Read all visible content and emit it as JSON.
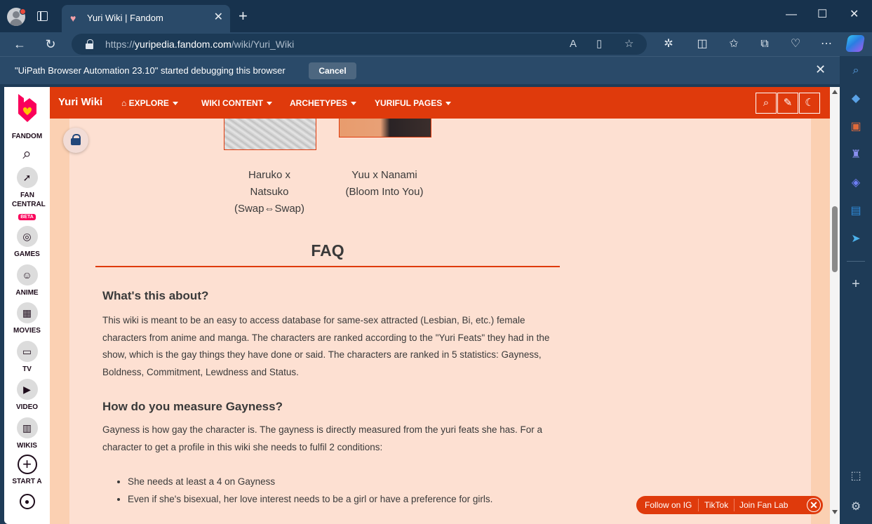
{
  "browser": {
    "tab_title": "Yuri Wiki | Fandom",
    "tab_close": "✕",
    "new_tab": "+",
    "url_prefix": "https://",
    "url_domain": "yuripedia.fandom.com",
    "url_path": "/wiki/Yuri_Wiki",
    "window_controls": {
      "minimize": "—",
      "maximize": "☐",
      "close": "✕"
    }
  },
  "debug_bar": {
    "message": "\"UiPath Browser Automation 23.10\" started debugging this browser",
    "cancel_label": "Cancel",
    "close": "✕"
  },
  "rail": {
    "items": [
      {
        "label": "FANDOM"
      },
      {
        "label": "FAN CENTRAL",
        "badge": "BETA"
      },
      {
        "label": "GAMES"
      },
      {
        "label": "ANIME"
      },
      {
        "label": "MOVIES"
      },
      {
        "label": "TV"
      },
      {
        "label": "VIDEO"
      },
      {
        "label": "WIKIS"
      },
      {
        "label": "START A"
      }
    ]
  },
  "wiki_header": {
    "name": "Yuri Wiki",
    "nav": [
      {
        "label": "EXPLORE"
      },
      {
        "label": "WIKI CONTENT"
      },
      {
        "label": "ARCHETYPES"
      },
      {
        "label": "YURIFUL PAGES"
      }
    ]
  },
  "gallery": {
    "captions": [
      {
        "line1": "Haruko x",
        "line2": "Natsuko",
        "line3": "(Swap⇔Swap)"
      },
      {
        "line1": "Yuu x Nanami",
        "line2": "(Bloom Into You)"
      }
    ]
  },
  "faq": {
    "heading": "FAQ",
    "q1": "What's this about?",
    "a1": "This wiki is meant to be an easy to access database for same-sex attracted (Lesbian, Bi, etc.) female characters from anime and manga. The characters are ranked according to the \"Yuri Feats\" they had in the show, which is the gay things they have done or said. The characters are ranked in 5 statistics: Gayness, Boldness, Commitment, Lewdness and Status.",
    "q2": "How do you measure Gayness?",
    "a2": "Gayness is how gay the character is. The gayness is directly measured from the yuri feats she has. For a character to get a profile in this wiki she needs to fulfil 2 conditions:",
    "conditions": [
      "She needs at least a 4 on Gayness",
      "Even if she's bisexual, her love interest needs to be a girl or have a preference for girls."
    ]
  },
  "social": {
    "ig": "Follow on IG",
    "tiktok": "TikTok",
    "fanlab": "Join Fan Lab",
    "close": "✕"
  }
}
